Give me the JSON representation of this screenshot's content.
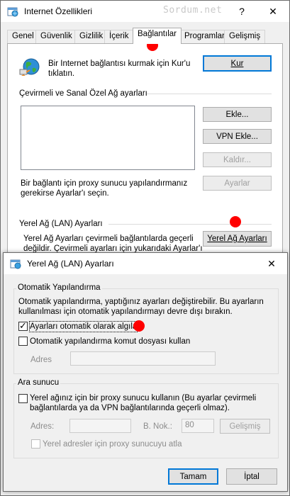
{
  "back_window": {
    "title": "Internet Özellikleri",
    "watermark": "Sordum.net",
    "help_glyph": "?",
    "close_glyph": "✕",
    "tabs": [
      "Genel",
      "Güvenlik",
      "Gizlilik",
      "İçerik",
      "Bağlantılar",
      "Programlar",
      "Gelişmiş"
    ],
    "active_tab": "Bağlantılar",
    "setup_text_line1": "Bir Internet bağlantısı kurmak için Kur'u",
    "setup_text_line2": "tıklatın.",
    "setup_button": "Kur",
    "dialup_section": "Çevirmeli ve Sanal Özel Ağ ayarları",
    "add_button": "Ekle...",
    "add_vpn_button": "VPN Ekle...",
    "remove_button": "Kaldır...",
    "settings_button": "Ayarlar",
    "proxy_text_line1": "Bir bağlantı için proxy sunucu yapılandırmanız",
    "proxy_text_line2": "gerekirse Ayarlar'ı seçin.",
    "lan_section": "Yerel Ağ (LAN) Ayarları",
    "lan_text_line1": "Yerel Ağ Ayarları çevirmeli bağlantılarda geçerli",
    "lan_text_line2": "değildir. Çevirmeli ayarları için yukarıdaki Ayarlar'ı",
    "lan_button": "Yerel Ağ Ayarları"
  },
  "dialog": {
    "title": "Yerel Ağ (LAN) Ayarları",
    "close_glyph": "✕",
    "auto_group": "Otomatik Yapılandırma",
    "auto_desc_line1": "Otomatik yapılandırma, yaptığınız ayarları değiştirebilir. Bu ayarların",
    "auto_desc_line2": "kullanılması için otomatik yapılandırmayı devre dışı bırakın.",
    "auto_detect_label": "Ayarları otomatik olarak algıla",
    "auto_detect_checked": true,
    "auto_script_label": "Otomatik yapılandırma komut dosyası kullan",
    "auto_script_checked": false,
    "address_label": "Adres",
    "address_value": "",
    "proxy_group": "Ara sunucu",
    "proxy_use_line1": "Yerel ağınız için bir proxy sunucu kullanın (Bu ayarlar çevirmeli",
    "proxy_use_line2": "bağlantılarda ya da VPN bağlantılarında geçerli olmaz).",
    "proxy_use_checked": false,
    "proxy_address_label": "Adres:",
    "proxy_address_value": "",
    "port_label": "B. Nok.:",
    "port_value": "80",
    "advanced_button": "Gelişmiş",
    "bypass_label": "Yerel adresler için proxy sunucuyu atla",
    "bypass_checked": false,
    "ok_button": "Tamam",
    "cancel_button": "İptal",
    "checkmark_glyph": "✓"
  },
  "colors": {
    "annotation_red": "#ff0000",
    "default_button_border": "#0078d7",
    "disabled_text": "#a0a0a0"
  }
}
